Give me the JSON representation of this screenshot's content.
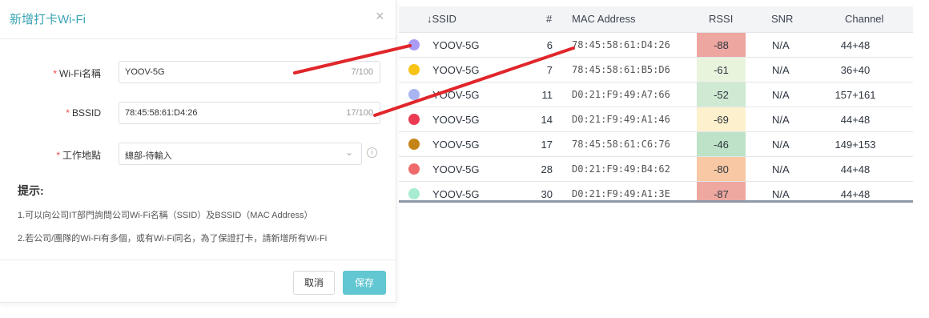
{
  "dialog": {
    "title": "新增打卡Wi-Fi",
    "close_glyph": "×",
    "wifi_label": "Wi-Fi名稱",
    "wifi_value": "YOOV-5G",
    "wifi_count": "7/100",
    "bssid_label": "BSSID",
    "bssid_value": "78:45:58:61:D4:26",
    "bssid_count": "17/100",
    "location_label": "工作地點",
    "location_value": "總部-待輸入",
    "required_mark": "*",
    "info_glyph": "i",
    "chevron_glyph": "⌄",
    "tips_title": "提示:",
    "tips": [
      "1.可以向公司IT部門詢問公司Wi-Fi名稱（SSID）及BSSID（MAC Address）",
      "2.若公司/團隊的Wi-Fi有多個，或有Wi-Fi同名，為了保證打卡，請新增所有Wi-Fi"
    ],
    "cancel_label": "取消",
    "save_label": "保存"
  },
  "table": {
    "headers": {
      "ssid": "↓SSID",
      "num": "#",
      "mac": "MAC Address",
      "rssi": "RSSI",
      "snr": "SNR",
      "channel": "Channel"
    },
    "rows": [
      {
        "color": "#a89cf5",
        "ssid": "YOOV-5G",
        "num": "6",
        "mac": "78:45:58:61:D4:26",
        "rssi": "-88",
        "rssi_bg": "#eda6a0",
        "snr": "N/A",
        "channel": "44+48"
      },
      {
        "color": "#f7c315",
        "ssid": "YOOV-5G",
        "num": "7",
        "mac": "78:45:58:61:B5:D6",
        "rssi": "-61",
        "rssi_bg": "#e9f4dd",
        "snr": "N/A",
        "channel": "36+40"
      },
      {
        "color": "#a9b5f2",
        "ssid": "YOOV-5G",
        "num": "11",
        "mac": "D0:21:F9:49:A7:66",
        "rssi": "-52",
        "rssi_bg": "#cfe9d2",
        "snr": "N/A",
        "channel": "157+161"
      },
      {
        "color": "#ea3b52",
        "ssid": "YOOV-5G",
        "num": "14",
        "mac": "D0:21:F9:49:A1:46",
        "rssi": "-69",
        "rssi_bg": "#fdf0cc",
        "snr": "N/A",
        "channel": "44+48"
      },
      {
        "color": "#c48418",
        "ssid": "YOOV-5G",
        "num": "17",
        "mac": "78:45:58:61:C6:76",
        "rssi": "-46",
        "rssi_bg": "#bde2c7",
        "snr": "N/A",
        "channel": "149+153"
      },
      {
        "color": "#ef6b6b",
        "ssid": "YOOV-5G",
        "num": "28",
        "mac": "D0:21:F9:49:B4:62",
        "rssi": "-80",
        "rssi_bg": "#f8c8a4",
        "snr": "N/A",
        "channel": "44+48"
      },
      {
        "color": "#a7ecd0",
        "ssid": "YOOV-5G",
        "num": "30",
        "mac": "D0:21:F9:49:A1:3E",
        "rssi": "-87",
        "rssi_bg": "#eea8a0",
        "snr": "N/A",
        "channel": "44+48"
      }
    ]
  },
  "annotation": {
    "color": "#e0262b"
  }
}
